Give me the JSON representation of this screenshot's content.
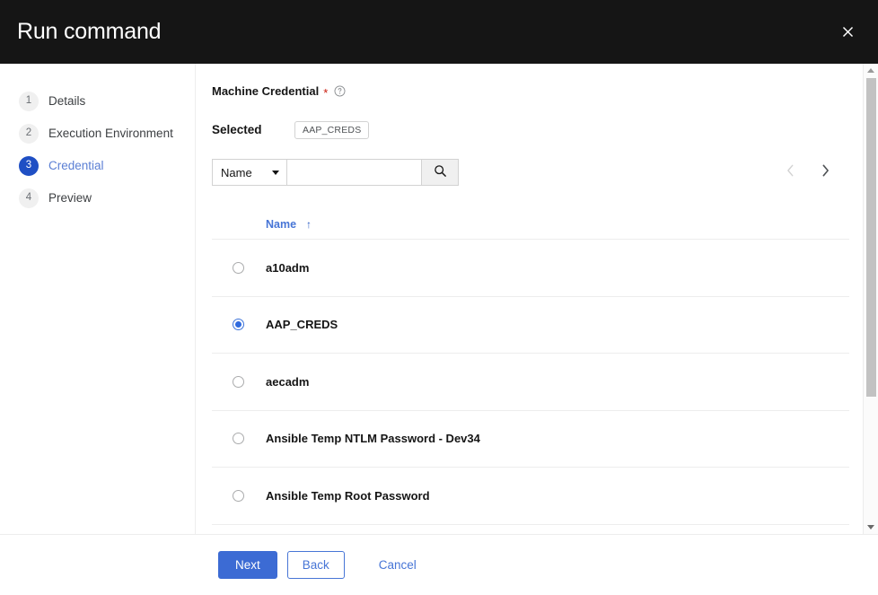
{
  "header": {
    "title": "Run command",
    "close_icon": "close-icon"
  },
  "wizard_nav": {
    "steps": [
      {
        "num": "1",
        "label": "Details",
        "active": false
      },
      {
        "num": "2",
        "label": "Execution Environment",
        "active": false
      },
      {
        "num": "3",
        "label": "Credential",
        "active": true
      },
      {
        "num": "4",
        "label": "Preview",
        "active": false
      }
    ]
  },
  "form": {
    "field_label": "Machine Credential",
    "required_marker": "*",
    "help_icon": "help-circle-icon",
    "selected_label": "Selected",
    "selected_chip": "AAP_CREDS"
  },
  "toolbar": {
    "filter_value": "Name",
    "filter_caret_icon": "chevron-down-icon",
    "search_value": "",
    "search_placeholder": "",
    "search_icon": "search-icon",
    "prev_icon": "chevron-left-icon",
    "next_icon": "chevron-right-icon"
  },
  "table": {
    "column_header": "Name",
    "sort_arrow": "↑",
    "rows": [
      {
        "name": "a10adm",
        "selected": false
      },
      {
        "name": "AAP_CREDS",
        "selected": true
      },
      {
        "name": "aecadm",
        "selected": false
      },
      {
        "name": "Ansible Temp NTLM Password - Dev34",
        "selected": false
      },
      {
        "name": "Ansible Temp Root Password",
        "selected": false
      }
    ]
  },
  "footer": {
    "next_label": "Next",
    "back_label": "Back",
    "cancel_label": "Cancel"
  },
  "colors": {
    "header_bg": "#151515",
    "accent_blue": "#3c6bd4",
    "link_blue": "#4775d6",
    "active_step_bg": "#1f4fc4",
    "required_red": "#c9190b",
    "border_gray": "#ededed"
  }
}
